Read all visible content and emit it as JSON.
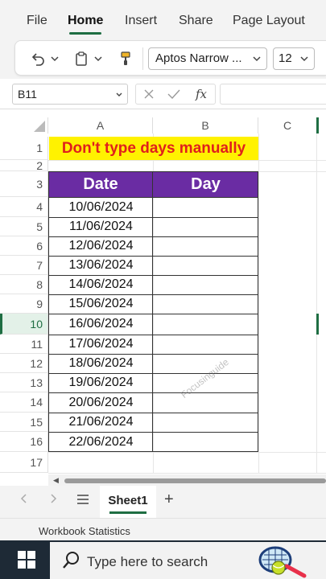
{
  "ribbon": {
    "tabs": [
      "File",
      "Home",
      "Insert",
      "Share",
      "Page Layout"
    ],
    "active_tab": "Home"
  },
  "toolbar": {
    "font_name": "Aptos Narrow ...",
    "font_size": "12"
  },
  "formula_bar": {
    "name_box": "B11",
    "fx": "fx"
  },
  "columns": [
    "A",
    "B",
    "C"
  ],
  "rows": [
    "1",
    "2",
    "3",
    "4",
    "5",
    "6",
    "7",
    "8",
    "9",
    "10",
    "11",
    "12",
    "13",
    "14",
    "15",
    "16",
    "17"
  ],
  "selected_row": "10",
  "sheet": {
    "title": "Don't type days manually",
    "header_date": "Date",
    "header_day": "Day",
    "dates": [
      "10/06/2024",
      "11/06/2024",
      "12/06/2024",
      "13/06/2024",
      "14/06/2024",
      "15/06/2024",
      "16/06/2024",
      "17/06/2024",
      "18/06/2024",
      "19/06/2024",
      "20/06/2024",
      "21/06/2024",
      "22/06/2024"
    ],
    "watermark": "Focusinguide"
  },
  "sheet_tabs": {
    "active": "Sheet1",
    "add": "+"
  },
  "status_bar": {
    "label": "Workbook Statistics"
  },
  "taskbar": {
    "search_placeholder": "Type here to search"
  },
  "colors": {
    "accent": "#1f6e43",
    "header_fill": "#6a2ca3",
    "title_fill": "#fff200",
    "title_text": "#e0201c"
  }
}
